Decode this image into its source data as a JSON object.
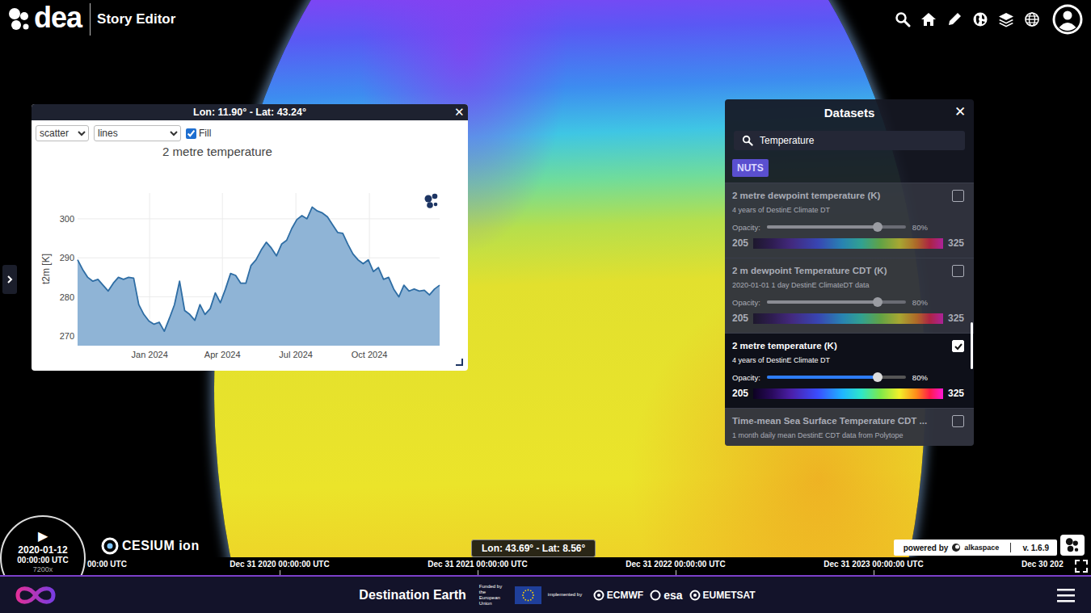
{
  "app_header": {
    "logo_text": "dea",
    "title": "Story Editor"
  },
  "chart_popup": {
    "title": "Lon: 11.90° - Lat: 43.24°",
    "close": "✕",
    "plot_type": "scatter",
    "plot_mode": "lines",
    "fill": {
      "label": "Fill",
      "checked": true
    },
    "chart": {
      "title": "2 metre temperature",
      "y_axis_label": "t2m [K]",
      "y_ticks": [
        "270",
        "280",
        "290",
        "300"
      ],
      "x_ticks": [
        "Jan 2024",
        "Apr 2024",
        "Jul 2024",
        "Oct 2024"
      ],
      "series": [
        {
          "name": "2 metre temperature",
          "values": [
            289.5,
            287,
            285,
            284,
            284.5,
            283,
            281.5,
            283.5,
            285,
            284.5,
            285,
            284.8,
            278,
            275.5,
            273.8,
            273,
            273.5,
            271.2,
            274.5,
            278,
            284,
            276.5,
            275.5,
            274,
            278,
            275.5,
            277,
            281,
            278.5,
            282,
            286,
            285.5,
            283.5,
            283.5,
            288,
            289.5,
            292,
            294,
            292.5,
            290.5,
            293.5,
            294.5,
            297.5,
            299.8,
            300.8,
            300,
            303,
            302,
            301.5,
            300.5,
            298.5,
            296.5,
            296.3,
            293.5,
            291,
            289.5,
            288.5,
            289.5,
            286.5,
            287.5,
            284.5,
            285,
            282,
            280,
            283,
            281.5,
            282,
            281.5,
            281.7,
            280.5,
            282,
            283
          ]
        }
      ]
    }
  },
  "datasets_panel": {
    "title": "Datasets",
    "close": "✕",
    "search": {
      "value": "Temperature"
    },
    "tags": [
      "NUTS"
    ],
    "items": [
      {
        "title": "2 metre dewpoint temperature (K)",
        "subtitle": "4 years of DestinE Climate DT",
        "checked": false,
        "opacity_label": "Opacity:",
        "level": 0.8,
        "reading": "80%",
        "range_min": "205",
        "range_max": "325"
      },
      {
        "title": "2 m dewpoint Temperature CDT (K)",
        "subtitle": "2020-01-01 1 day DestinE ClimateDT data",
        "checked": false,
        "opacity_label": "Opacity:",
        "level": 0.8,
        "reading": "80%",
        "range_min": "205",
        "range_max": "325"
      },
      {
        "title": "2 metre temperature (K)",
        "subtitle": "4 years of DestinE Climate DT",
        "checked": true,
        "opacity_label": "Opacity:",
        "level": 0.8,
        "reading": "80%",
        "range_min": "205",
        "range_max": "325"
      },
      {
        "title": "Time-mean Sea Surface Temperature CDT ...",
        "subtitle": "1 month daily mean DestinE CDT data from Polytope",
        "checked": false
      }
    ]
  },
  "map": {
    "hover_coordinates": "Lon: 43.69° - Lat: 8.56°"
  },
  "clock": {
    "play": "▶",
    "date": "2020-01-12",
    "time": "00:00:00 UTC",
    "speed": "7200x"
  },
  "timeline": {
    "labels": [
      "00:00 UTC",
      "Dec 31 2020 00:00:00 UTC",
      "Dec 31 2021 00:00:00 UTC",
      "Dec 31 2022 00:00:00 UTC",
      "Dec 31 2023 00:00:00 UTC",
      "Dec 30 202"
    ]
  },
  "attribution": {
    "cesium": "CESIUM ion",
    "powered_by": "powered by",
    "brand": "alkaspace",
    "version": "v. 1.6.9"
  },
  "footer": {
    "title": "Destination Earth",
    "funded_by": "Funded by the European Union",
    "implemented_by": "implemented by",
    "partners": [
      "ECMWF",
      "esa",
      "EUMETSAT"
    ]
  }
}
